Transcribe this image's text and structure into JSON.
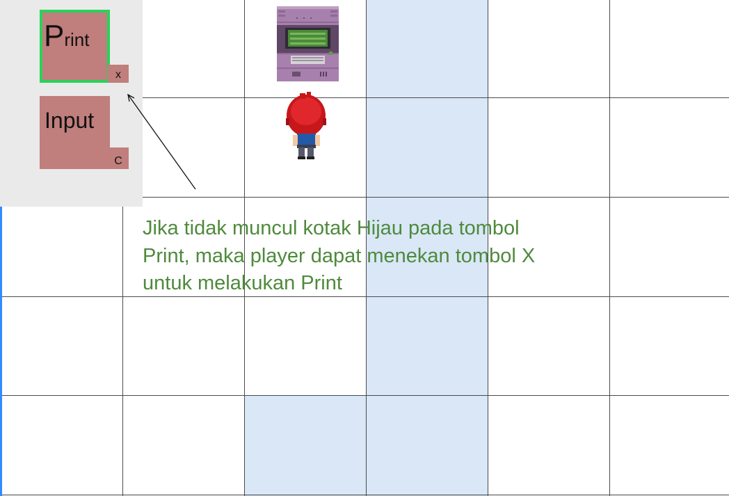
{
  "controls": {
    "print": {
      "label_first": "P",
      "label_rest": "rint",
      "key": "x",
      "highlighted": true,
      "highlight_color": "#27d35a"
    },
    "input": {
      "label": "Input",
      "key": "C"
    }
  },
  "note": {
    "text": "Jika tidak muncul kotak Hijau pada tombol Print, maka player dapat menekan tombol X untuk melakukan Print"
  },
  "colors": {
    "button": "#c07e7c",
    "panel": "#eaeaea",
    "note_text": "#4e8a3c",
    "highlight_tile": "#d9e7f7",
    "grid_line": "#4a4a4a"
  },
  "sprites": {
    "computer": "computer-terminal-sprite",
    "player": "player-red-hair-sprite"
  }
}
